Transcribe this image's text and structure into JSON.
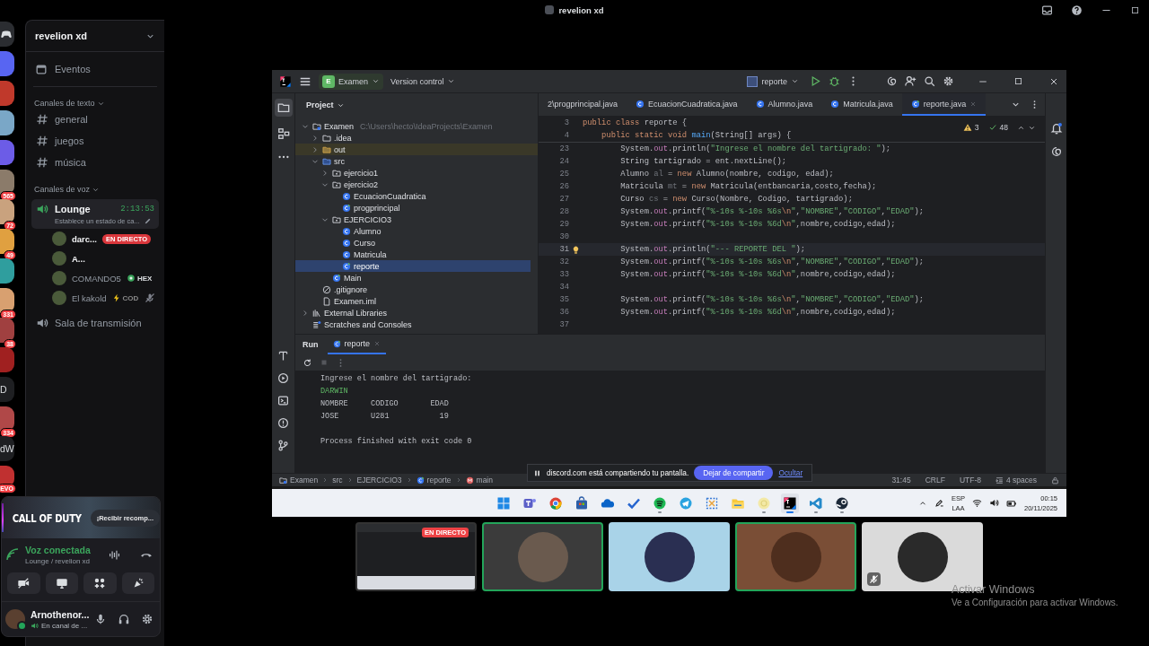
{
  "window": {
    "title": "revelion xd"
  },
  "server_rail": [
    {
      "kind": "logo"
    },
    {
      "kind": "server"
    },
    {
      "kind": "server"
    },
    {
      "kind": "server"
    },
    {
      "kind": "server"
    },
    {
      "kind": "server",
      "badge": "565"
    },
    {
      "kind": "server",
      "badge": "72"
    },
    {
      "kind": "server",
      "badge": "49"
    },
    {
      "kind": "server"
    },
    {
      "kind": "server",
      "badge": "331"
    },
    {
      "kind": "server",
      "badge": "38"
    },
    {
      "kind": "server"
    },
    {
      "kind": "text",
      "label": "D"
    },
    {
      "kind": "server",
      "badge": "334"
    },
    {
      "kind": "text",
      "label": "dW"
    },
    {
      "kind": "server",
      "badge": "EVO"
    }
  ],
  "sidebar": {
    "server_name": "revelion xd",
    "events": "Eventos",
    "categories": [
      {
        "kind": "text",
        "label": "Canales de texto",
        "channels": [
          {
            "name": "general",
            "selected": false
          },
          {
            "name": "juegos",
            "selected": false
          },
          {
            "name": "música",
            "selected": false
          }
        ]
      },
      {
        "kind": "voice",
        "label": "Canales de voz",
        "channels": [
          {
            "name": "Lounge",
            "selected": true,
            "timer": "2:13:53",
            "status": "Establece un estado de ca...",
            "members": [
              {
                "name": "darc...",
                "active": true,
                "muted": false,
                "badge": "EN DIRECTO"
              },
              {
                "name": "A...",
                "active": true,
                "muted": false
              },
              {
                "name": "COMANDO5",
                "active": false,
                "muted": false,
                "tag": "HEX"
              },
              {
                "name": "El kakold",
                "active": false,
                "muted": true,
                "tag": "COD"
              }
            ]
          },
          {
            "name": "Sala de transmisión",
            "selected": false
          }
        ]
      }
    ]
  },
  "promo": {
    "logo": "CALL OF DUTY",
    "button": "¡Recibir recomp..."
  },
  "voice_panel": {
    "status": "Voz conectada",
    "channel": "Lounge / revelion xd"
  },
  "user_panel": {
    "name": "Arnothenor...",
    "status": "En canal de ..."
  },
  "stage": {
    "ide": {
      "toolbar": {
        "project_badge": "E",
        "project": "Examen",
        "vcs": "Version control",
        "run_config": "reporte"
      },
      "project_panel": {
        "title": "Project",
        "tree": [
          {
            "label": "Examen",
            "kind": "module",
            "hint": "C:\\Users\\hecto\\IdeaProjects\\Examen",
            "expanded": true,
            "selected": false,
            "children": [
              {
                "label": ".idea",
                "kind": "folder",
                "expanded": false,
                "selected": false
              },
              {
                "label": "out",
                "kind": "excluded",
                "expanded": false,
                "selected": false
              },
              {
                "label": "src",
                "kind": "source",
                "expanded": true,
                "selected": false,
                "children": [
                  {
                    "label": "ejercicio1",
                    "kind": "package",
                    "expanded": false,
                    "selected": false
                  },
                  {
                    "label": "ejercicio2",
                    "kind": "package",
                    "expanded": true,
                    "selected": false,
                    "children": [
                      {
                        "label": "EcuacionCuadratica",
                        "kind": "class",
                        "selected": false
                      },
                      {
                        "label": "progprincipal",
                        "kind": "main-class",
                        "selected": false
                      }
                    ]
                  },
                  {
                    "label": "EJERCICIO3",
                    "kind": "package",
                    "expanded": true,
                    "selected": false,
                    "children": [
                      {
                        "label": "Alumno",
                        "kind": "class",
                        "selected": false
                      },
                      {
                        "label": "Curso",
                        "kind": "class",
                        "selected": false
                      },
                      {
                        "label": "Matricula",
                        "kind": "class",
                        "selected": false
                      },
                      {
                        "label": "reporte",
                        "kind": "main-class",
                        "selected": true
                      }
                    ]
                  },
                  {
                    "label": "Main",
                    "kind": "main-class",
                    "selected": false
                  }
                ]
              },
              {
                "label": ".gitignore",
                "kind": "ignore-file",
                "selected": false
              },
              {
                "label": "Examen.iml",
                "kind": "iml-file",
                "selected": false
              }
            ]
          },
          {
            "label": "External Libraries",
            "kind": "libraries",
            "expanded": false,
            "selected": false
          },
          {
            "label": "Scratches and Consoles",
            "kind": "scratches",
            "selected": false
          }
        ]
      },
      "tabs": [
        {
          "label": "2\\progprincipal.java",
          "kind": "partial",
          "selected": false
        },
        {
          "label": "EcuacionCuadratica.java",
          "kind": "class",
          "selected": false
        },
        {
          "label": "Alumno.java",
          "kind": "class",
          "selected": false
        },
        {
          "label": "Matricula.java",
          "kind": "class",
          "selected": false
        },
        {
          "label": "reporte.java",
          "kind": "main-class",
          "selected": true
        }
      ],
      "inspections": {
        "warnings": "3",
        "checks": "48"
      },
      "sticky_lines": [
        {
          "number": "3",
          "code": [
            {
              "kind": "kw",
              "text": "public class "
            },
            {
              "kind": "plain",
              "text": "reporte {"
            }
          ]
        },
        {
          "number": "4",
          "code": [
            {
              "kind": "kw",
              "text": "    public static void "
            },
            {
              "kind": "fn",
              "text": "main"
            },
            {
              "kind": "plain",
              "text": "(String[] args) {"
            }
          ]
        }
      ],
      "lines": [
        {
          "number": "23",
          "current": false,
          "code": [
            {
              "kind": "plain",
              "text": "        System."
            },
            {
              "kind": "field",
              "text": "out"
            },
            {
              "kind": "plain",
              "text": ".println("
            },
            {
              "kind": "str",
              "text": "\"Ingrese el nombre del tartigrado: \""
            },
            {
              "kind": "plain",
              "text": ");"
            }
          ]
        },
        {
          "number": "24",
          "current": false,
          "code": [
            {
              "kind": "plain",
              "text": "        String tartigrado = ent.nextLine();"
            }
          ]
        },
        {
          "number": "25",
          "current": false,
          "code": [
            {
              "kind": "plain",
              "text": "        Alumno "
            },
            {
              "kind": "unused",
              "text": "al"
            },
            {
              "kind": "plain",
              "text": " = "
            },
            {
              "kind": "kw",
              "text": "new"
            },
            {
              "kind": "plain",
              "text": " Alumno(nombre, codigo, edad);"
            }
          ]
        },
        {
          "number": "26",
          "current": false,
          "code": [
            {
              "kind": "plain",
              "text": "        Matricula "
            },
            {
              "kind": "unused",
              "text": "mt"
            },
            {
              "kind": "plain",
              "text": " = "
            },
            {
              "kind": "kw",
              "text": "new"
            },
            {
              "kind": "plain",
              "text": " Matricula(entbancaria,costo,fecha);"
            }
          ]
        },
        {
          "number": "27",
          "current": false,
          "code": [
            {
              "kind": "plain",
              "text": "        Curso "
            },
            {
              "kind": "unused",
              "text": "cs"
            },
            {
              "kind": "plain",
              "text": " = "
            },
            {
              "kind": "kw",
              "text": "new"
            },
            {
              "kind": "plain",
              "text": " Curso(Nombre, Codigo, tartigrado);"
            }
          ]
        },
        {
          "number": "28",
          "current": false,
          "code": [
            {
              "kind": "plain",
              "text": "        System."
            },
            {
              "kind": "field",
              "text": "out"
            },
            {
              "kind": "plain",
              "text": ".printf("
            },
            {
              "kind": "str",
              "text": "\"%-10s %-10s %6s"
            },
            {
              "kind": "kw",
              "text": "\\n"
            },
            {
              "kind": "str",
              "text": "\""
            },
            {
              "kind": "plain",
              "text": ","
            },
            {
              "kind": "str",
              "text": "\"NOMBRE\""
            },
            {
              "kind": "plain",
              "text": ","
            },
            {
              "kind": "str",
              "text": "\"CODIGO\""
            },
            {
              "kind": "plain",
              "text": ","
            },
            {
              "kind": "str",
              "text": "\"EDAD\""
            },
            {
              "kind": "plain",
              "text": ");"
            }
          ]
        },
        {
          "number": "29",
          "current": false,
          "code": [
            {
              "kind": "plain",
              "text": "        System."
            },
            {
              "kind": "field",
              "text": "out"
            },
            {
              "kind": "plain",
              "text": ".printf("
            },
            {
              "kind": "str",
              "text": "\"%-10s %-10s %6d"
            },
            {
              "kind": "kw",
              "text": "\\n"
            },
            {
              "kind": "str",
              "text": "\""
            },
            {
              "kind": "plain",
              "text": ",nombre,codigo,edad);"
            }
          ]
        },
        {
          "number": "30",
          "current": false
        },
        {
          "number": "31",
          "current": true,
          "code": [
            {
              "kind": "plain",
              "text": "        System."
            },
            {
              "kind": "field",
              "text": "out"
            },
            {
              "kind": "plain",
              "text": ".println("
            },
            {
              "kind": "str",
              "text": "\"--- REPORTE DEL \""
            },
            {
              "kind": "plain",
              "text": ");"
            }
          ]
        },
        {
          "number": "32",
          "current": false,
          "code": [
            {
              "kind": "plain",
              "text": "        System."
            },
            {
              "kind": "field",
              "text": "out"
            },
            {
              "kind": "plain",
              "text": ".printf("
            },
            {
              "kind": "str",
              "text": "\"%-10s %-10s %6s"
            },
            {
              "kind": "kw",
              "text": "\\n"
            },
            {
              "kind": "str",
              "text": "\""
            },
            {
              "kind": "plain",
              "text": ","
            },
            {
              "kind": "str",
              "text": "\"NOMBRE\""
            },
            {
              "kind": "plain",
              "text": ","
            },
            {
              "kind": "str",
              "text": "\"CODIGO\""
            },
            {
              "kind": "plain",
              "text": ","
            },
            {
              "kind": "str",
              "text": "\"EDAD\""
            },
            {
              "kind": "plain",
              "text": ");"
            }
          ]
        },
        {
          "number": "33",
          "current": false,
          "code": [
            {
              "kind": "plain",
              "text": "        System."
            },
            {
              "kind": "field",
              "text": "out"
            },
            {
              "kind": "plain",
              "text": ".printf("
            },
            {
              "kind": "str",
              "text": "\"%-10s %-10s %6d"
            },
            {
              "kind": "kw",
              "text": "\\n"
            },
            {
              "kind": "str",
              "text": "\""
            },
            {
              "kind": "plain",
              "text": ",nombre,codigo,edad);"
            }
          ]
        },
        {
          "number": "34",
          "current": false
        },
        {
          "number": "35",
          "current": false,
          "code": [
            {
              "kind": "plain",
              "text": "        System."
            },
            {
              "kind": "field",
              "text": "out"
            },
            {
              "kind": "plain",
              "text": ".printf("
            },
            {
              "kind": "str",
              "text": "\"%-10s %-10s %6s"
            },
            {
              "kind": "kw",
              "text": "\\n"
            },
            {
              "kind": "str",
              "text": "\""
            },
            {
              "kind": "plain",
              "text": ","
            },
            {
              "kind": "str",
              "text": "\"NOMBRE\""
            },
            {
              "kind": "plain",
              "text": ","
            },
            {
              "kind": "str",
              "text": "\"CODIGO\""
            },
            {
              "kind": "plain",
              "text": ","
            },
            {
              "kind": "str",
              "text": "\"EDAD\""
            },
            {
              "kind": "plain",
              "text": ");"
            }
          ]
        },
        {
          "number": "36",
          "current": false,
          "code": [
            {
              "kind": "plain",
              "text": "        System."
            },
            {
              "kind": "field",
              "text": "out"
            },
            {
              "kind": "plain",
              "text": ".printf("
            },
            {
              "kind": "str",
              "text": "\"%-10s %-10s %6d"
            },
            {
              "kind": "kw",
              "text": "\\n"
            },
            {
              "kind": "str",
              "text": "\""
            },
            {
              "kind": "plain",
              "text": ",nombre,codigo,edad);"
            }
          ]
        },
        {
          "number": "37",
          "current": false
        }
      ],
      "run_panel": {
        "title": "Run",
        "tabs": [
          {
            "label": "reporte",
            "selected": true
          }
        ],
        "console": [
          {
            "kind": "output",
            "text": "Ingrese el nombre del tartigrado:"
          },
          {
            "kind": "input",
            "text": "DARWIN"
          },
          {
            "kind": "output",
            "text": "NOMBRE     CODIGO       EDAD"
          },
          {
            "kind": "output",
            "text": "JOSE       U281           19"
          },
          {
            "kind": "blank"
          },
          {
            "kind": "output",
            "text": "Process finished with exit code 0"
          }
        ]
      },
      "breadcrumb": [
        {
          "label": "Examen",
          "kind": "module"
        },
        {
          "label": "src",
          "kind": "plain"
        },
        {
          "label": "EJERCICIO3",
          "kind": "plain"
        },
        {
          "label": "reporte",
          "kind": "main-class"
        },
        {
          "label": "main",
          "kind": "method"
        }
      ],
      "status_items": [
        {
          "label": "31:45",
          "kind": "text"
        },
        {
          "label": "CRLF",
          "kind": "text"
        },
        {
          "label": "UTF-8",
          "kind": "text"
        },
        {
          "label": "4 spaces",
          "kind": "indent"
        }
      ],
      "share_notice": {
        "text": "discord.com está compartiendo tu pantalla.",
        "stop": "Dejar de compartir",
        "hide": "Ocultar"
      },
      "taskbar": {
        "apps": [
          {
            "kind": "start",
            "running": false,
            "active": false
          },
          {
            "kind": "teams",
            "running": false,
            "active": false
          },
          {
            "kind": "chrome",
            "running": false,
            "active": false
          },
          {
            "kind": "store",
            "running": false,
            "active": false
          },
          {
            "kind": "onedrive",
            "running": false,
            "active": false
          },
          {
            "kind": "todo",
            "running": false,
            "active": false
          },
          {
            "kind": "spotify",
            "running": true,
            "active": false
          },
          {
            "kind": "telegram",
            "running": false,
            "active": false
          },
          {
            "kind": "snip",
            "running": false,
            "active": false
          },
          {
            "kind": "files",
            "running": false,
            "active": false
          },
          {
            "kind": "app",
            "running": true,
            "active": false
          },
          {
            "kind": "intellij",
            "running": true,
            "active": true
          },
          {
            "kind": "vscode",
            "running": true,
            "active": false
          },
          {
            "kind": "steam",
            "running": true,
            "active": false
          }
        ],
        "lang": "ESP",
        "layout": "LAA",
        "time": "00:15",
        "date": "20/11/2025"
      }
    },
    "tiles": [
      {
        "kind": "screen",
        "badge": "EN DIRECTO",
        "speaking": false,
        "muted": false
      },
      {
        "kind": "avatar",
        "speaking": true,
        "muted": false
      },
      {
        "kind": "avatar",
        "speaking": false,
        "muted": false
      },
      {
        "kind": "avatar",
        "speaking": true,
        "muted": false
      },
      {
        "kind": "avatar",
        "speaking": false,
        "muted": true
      }
    ]
  },
  "windows_notice": {
    "title": "Activar Windows",
    "text": "Ve a Configuración para activar Windows."
  }
}
